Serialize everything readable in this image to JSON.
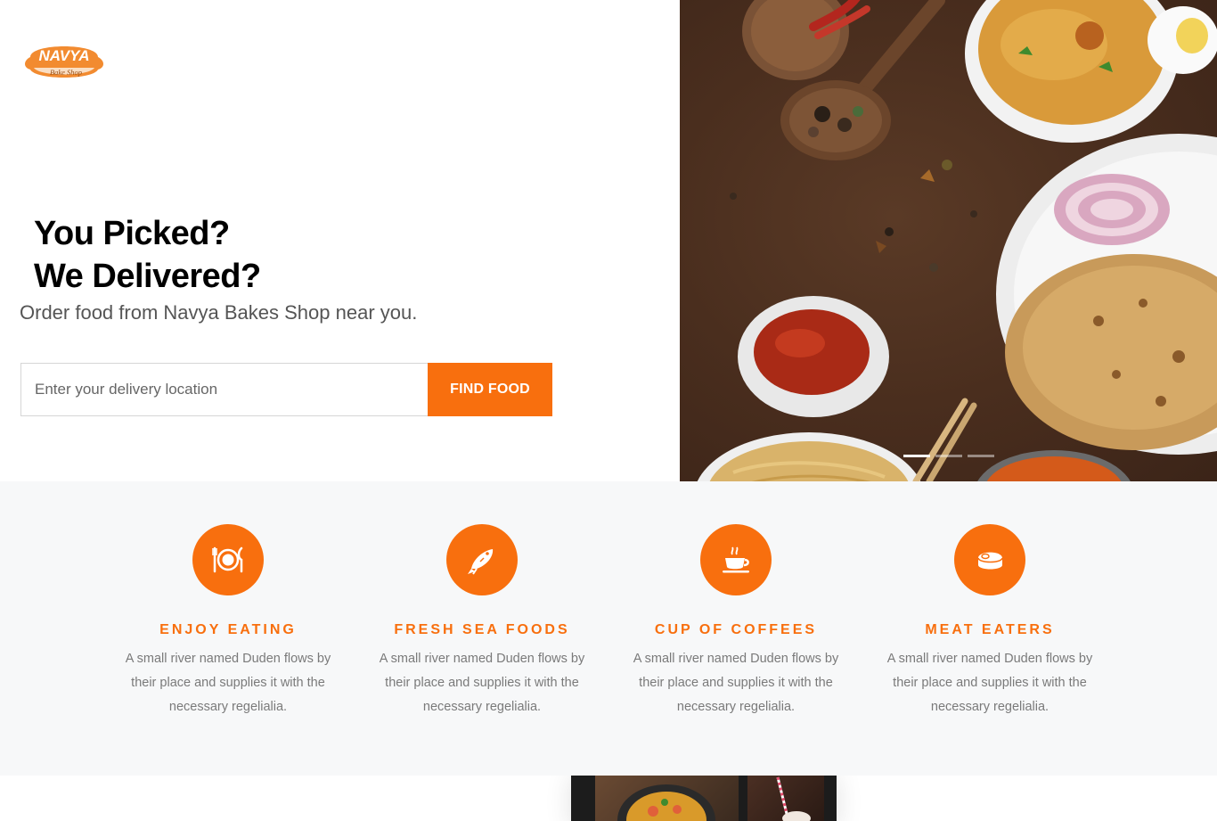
{
  "brand": {
    "name": "Navya",
    "tagline": "Bake Shop",
    "accent_color": "#f86f0e"
  },
  "hero": {
    "headline_line1": "You Picked?",
    "headline_line2": "We Delivered?",
    "subheadline": "Order food from Navya Bakes Shop near you.",
    "search": {
      "placeholder": "Enter your delivery location",
      "value": "",
      "button_label": "FIND FOOD"
    },
    "slider": {
      "slide_count": 3,
      "active_index": 0
    }
  },
  "services": [
    {
      "icon": "dinner-plate-icon",
      "title": "Enjoy Eating",
      "description": "A small river named Duden flows by their place and supplies it with the necessary regelialia."
    },
    {
      "icon": "fish-icon",
      "title": "Fresh Sea Foods",
      "description": "A small river named Duden flows by their place and supplies it with the necessary regelialia."
    },
    {
      "icon": "coffee-cup-icon",
      "title": "Cup Of Coffees",
      "description": "A small river named Duden flows by their place and supplies it with the necessary regelialia."
    },
    {
      "icon": "steak-icon",
      "title": "Meat Eaters",
      "description": "A small river named Duden flows by their place and supplies it with the necessary regelialia."
    }
  ]
}
